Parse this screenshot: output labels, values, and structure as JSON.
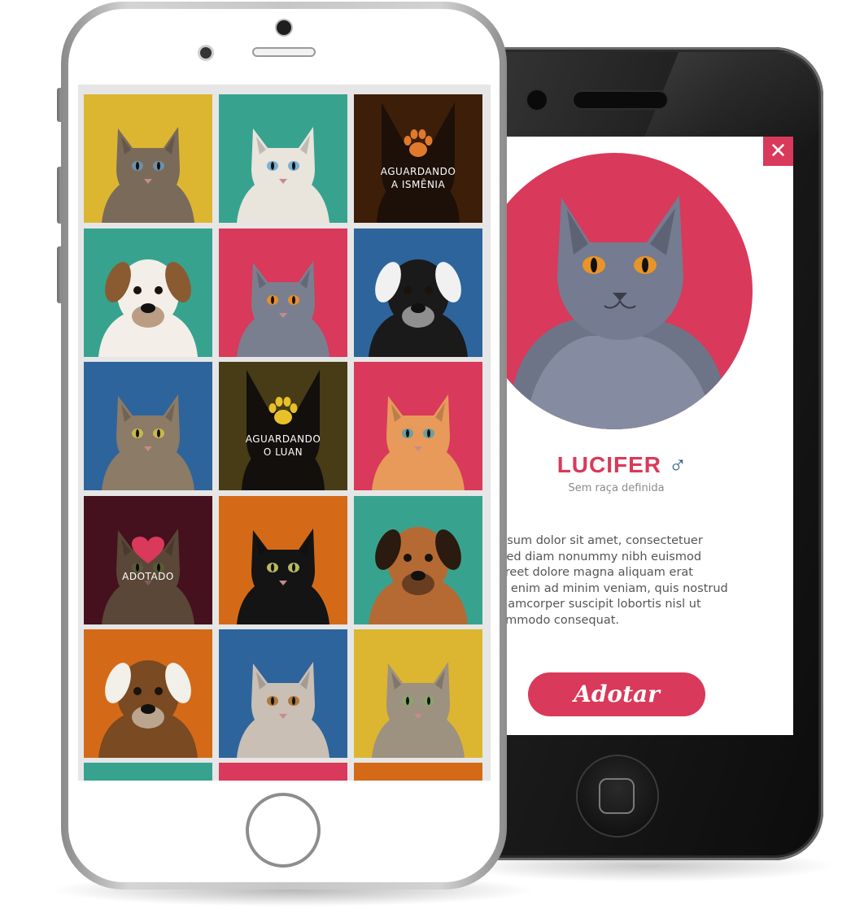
{
  "back_phone": {
    "close_label": "✕",
    "pet": {
      "name": "LUCIFER",
      "gender_symbol": "♂",
      "breed": "Sem raça definida",
      "description": [
        "Lorem ipsum dolor sit amet, consectetuer",
        "ng elit, sed diam nonummy nibh euismod",
        "nt ut laoreet dolore magna aliquam erat",
        "t. Ut wisi enim ad minim veniam, quis nostrud",
        "tation ullamcorper suscipit lobortis nisl ut",
        "ex ea commodo consequat."
      ]
    },
    "adopt_label": "Adotar"
  },
  "grid": {
    "tiles": [
      {
        "kind": "cat",
        "bg": "#dcb630",
        "fur": "#7a6a5a",
        "eyes": "#6f8fa8"
      },
      {
        "kind": "cat",
        "bg": "#37a38f",
        "fur": "#e9e4dc",
        "eyes": "#7bb1d4"
      },
      {
        "kind": "status",
        "bg": "#5e2f0e",
        "fur": "#2b1a0e",
        "paw": "#e0792b",
        "status_line1": "AGUARDANDO",
        "status_line2": "A ISMÊNIA"
      },
      {
        "kind": "dog",
        "bg": "#37a38f",
        "fur": "#f3efe8",
        "patch": "#8a5a30"
      },
      {
        "kind": "cat",
        "bg": "#d9395a",
        "fur": "#7a7f90",
        "eyes": "#e68f2a"
      },
      {
        "kind": "dog",
        "bg": "#2e649c",
        "fur": "#1a1a1a",
        "patch": "#f1f1f1"
      },
      {
        "kind": "cat",
        "bg": "#2e649c",
        "fur": "#8c7b66",
        "eyes": "#c9b84b"
      },
      {
        "kind": "status",
        "bg": "#6e5d21",
        "fur": "#1c1814",
        "paw": "#e8c02a",
        "status_line1": "AGUARDANDO",
        "status_line2": "O LUAN"
      },
      {
        "kind": "cat",
        "bg": "#d9395a",
        "fur": "#e79a5a",
        "eyes": "#6aa0a0"
      },
      {
        "kind": "heart",
        "bg": "#6a1b2e",
        "fur": "#8a6d55",
        "heart": "#d9395a",
        "status_line1": "ADOTADO"
      },
      {
        "kind": "cat",
        "bg": "#d46a17",
        "fur": "#141414",
        "eyes": "#b8b860"
      },
      {
        "kind": "dog",
        "bg": "#37a38f",
        "fur": "#b56a34",
        "patch": "#2a1a10"
      },
      {
        "kind": "dog",
        "bg": "#d46a17",
        "fur": "#7a4a22",
        "patch": "#f3f0ea"
      },
      {
        "kind": "cat",
        "bg": "#2e649c",
        "fur": "#c9bfb4",
        "eyes": "#b07a3a"
      },
      {
        "kind": "cat",
        "bg": "#dcb630",
        "fur": "#9d9180",
        "eyes": "#8aa66a"
      }
    ],
    "partial_row": [
      "#37a38f",
      "#d9395a",
      "#d46a17"
    ]
  },
  "colors": {
    "accent": "#d9395a",
    "male_blue": "#2d5b86"
  }
}
